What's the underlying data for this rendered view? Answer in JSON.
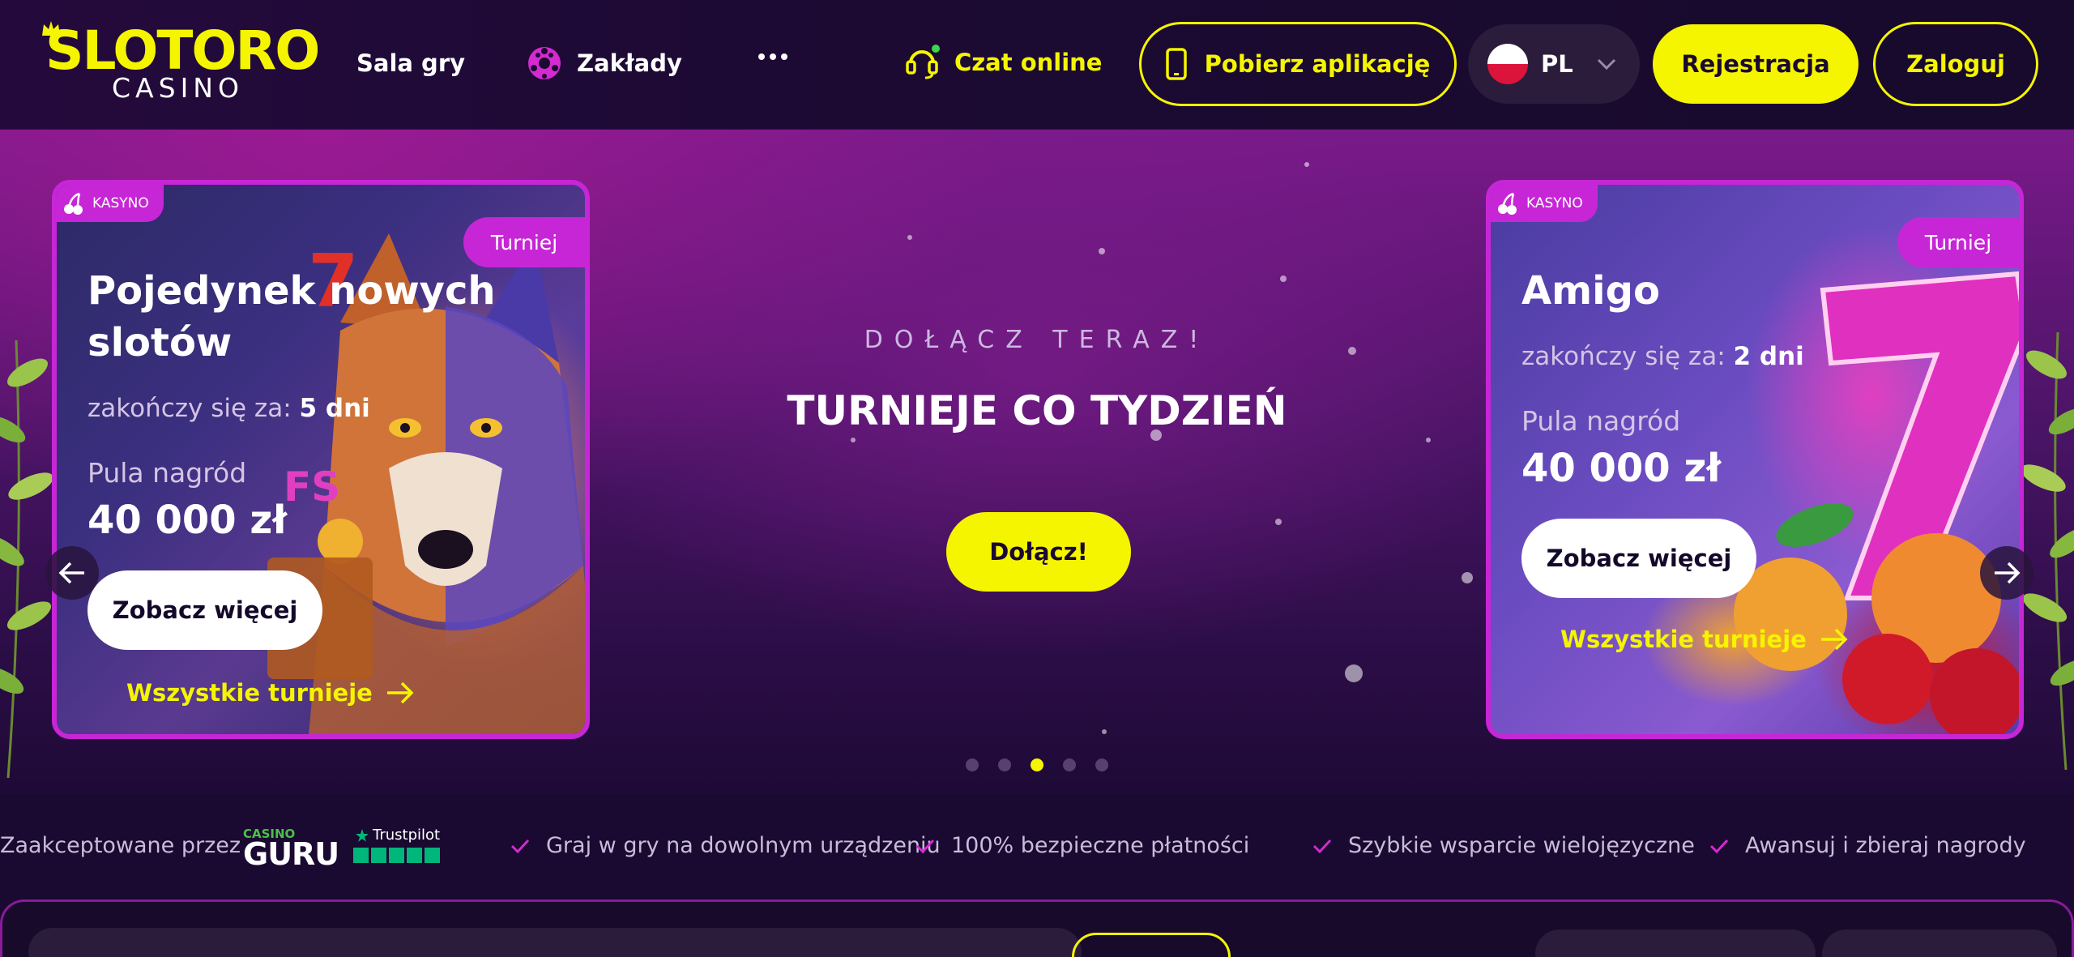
{
  "header": {
    "logo_main": "SLOTORO",
    "logo_sub": "CASINO",
    "nav": {
      "sala_gry": "Sala gry",
      "zaklady": "Zakłady"
    },
    "chat_label": "Czat online",
    "app_button": "Pobierz aplikację",
    "language": "PL",
    "register_button": "Rejestracja",
    "login_button": "Zaloguj"
  },
  "hero": {
    "kicker": "DOŁĄCZ TERAZ!",
    "title": "TURNIEJE CO TYDZIEŃ",
    "join_button": "Dołącz!",
    "active_dot": 3,
    "dot_count": 5,
    "cards": [
      {
        "tag": "KASYNO",
        "badge": "Turniej",
        "title": "Pojedynek nowych slotów",
        "ends_label": "zakończy się za:",
        "ends_value": "5 dni",
        "pool_label": "Pula nagród",
        "pool_value": "40 000 zł",
        "button": "Zobacz więcej",
        "link": "Wszystkie turnieje"
      },
      {
        "tag": "KASYNO",
        "badge": "Turniej",
        "title": "Amigo",
        "ends_label": "zakończy się za:",
        "ends_value": "2 dni",
        "pool_label": "Pula nagród",
        "pool_value": "40 000 zł",
        "button": "Zobacz więcej",
        "link": "Wszystkie turnieje"
      }
    ]
  },
  "trust": {
    "accepted_label": "Zaakceptowane przez",
    "casino_guru_small": "CASINO",
    "casino_guru_big": "GURU",
    "trustpilot": "Trustpilot",
    "features": [
      "Graj w gry na dowolnym urządzeniu",
      "100% bezpieczne płatności",
      "Szybkie wsparcie wielojęzyczne",
      "Awansuj i zbieraj nagrody"
    ]
  },
  "colors": {
    "accent_yellow": "#f5f500",
    "card_border": "#c726d6",
    "header_bg": "#1c0a33"
  },
  "icons": [
    "crown-icon",
    "soccer-ball-icon",
    "more-dots-icon",
    "headset-icon",
    "phone-icon",
    "poland-flag-icon",
    "chevron-down-icon",
    "cherry-icon",
    "arrow-right-icon",
    "arrow-left-icon",
    "check-icon",
    "trustpilot-star-icon"
  ]
}
